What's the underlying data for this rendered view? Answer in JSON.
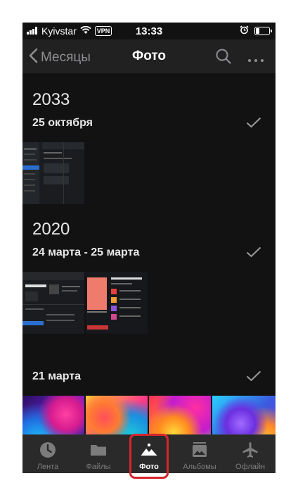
{
  "status_bar": {
    "carrier": "Kyivstar",
    "vpn": "VPN",
    "time": "13:33",
    "icons": [
      "signal-icon",
      "wifi-icon",
      "alarm-icon",
      "battery-icon"
    ]
  },
  "header": {
    "back_label": "Месяцы",
    "title": "Фото",
    "icons": [
      "chevron-left-icon",
      "search-icon",
      "more-icon"
    ]
  },
  "sections": [
    {
      "year": "2033",
      "date": "25 октября"
    },
    {
      "year": "2020",
      "date": "24 марта - 25 марта"
    },
    {
      "date": "21 марта"
    }
  ],
  "tabs": [
    {
      "label": "Лента",
      "icon": "clock-icon"
    },
    {
      "label": "Файлы",
      "icon": "folder-icon"
    },
    {
      "label": "Фото",
      "icon": "photo-icon",
      "active": true
    },
    {
      "label": "Альбомы",
      "icon": "album-icon"
    },
    {
      "label": "Офлайн",
      "icon": "airplane-icon"
    }
  ],
  "colors": {
    "background": "#121212",
    "navbar": "#212121",
    "tabbar": "#2a2a2a",
    "highlight": "#d6262d"
  }
}
